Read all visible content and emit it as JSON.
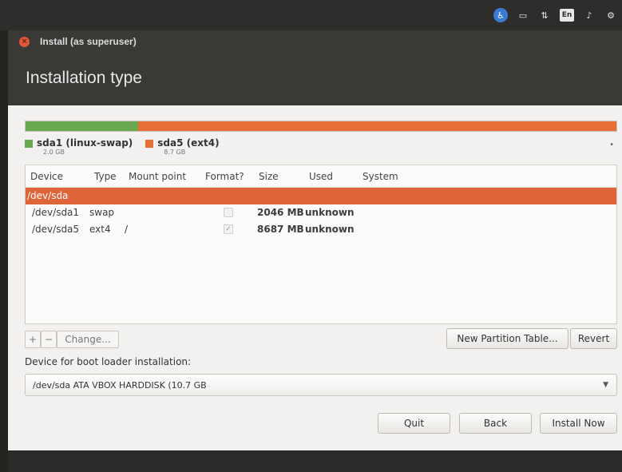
{
  "window": {
    "title": "Install (as superuser)",
    "heading": "Installation type"
  },
  "tray": {
    "accessibility_glyph": "♿",
    "battery_glyph": "▭",
    "network_glyph": "⇅",
    "keyboard_layout": "En",
    "volume_glyph": "♪",
    "settings_glyph": "⚙"
  },
  "partitions": {
    "colors": {
      "swap": "#6aa84f",
      "ext4": "#e66f35"
    },
    "legend": [
      {
        "name": "sda1 (linux-swap)",
        "size": "2.0 GB",
        "color": "#6aa84f"
      },
      {
        "name": "sda5 (ext4)",
        "size": "8.7 GB",
        "color": "#e66f35"
      }
    ],
    "more_glyph": "•"
  },
  "table": {
    "headers": {
      "device": "Device",
      "type": "Type",
      "mount_point": "Mount point",
      "format": "Format?",
      "size": "Size",
      "used": "Used",
      "system": "System"
    },
    "rows": [
      {
        "device": "/dev/sda",
        "type": "",
        "mount": "",
        "format": "",
        "size": "",
        "used": "",
        "system": ""
      },
      {
        "device": "/dev/sda1",
        "type": "swap",
        "mount": "",
        "format": "",
        "size": "2046 MB",
        "used": "unknown",
        "system": ""
      },
      {
        "device": "/dev/sda5",
        "type": "ext4",
        "mount": "/",
        "format": "✓",
        "size": "8687 MB",
        "used": "unknown",
        "system": ""
      }
    ]
  },
  "toolbar": {
    "add": "+",
    "remove": "−",
    "change": "Change...",
    "new_partition_table": "New Partition Table...",
    "revert": "Revert"
  },
  "boot_loader": {
    "label": "Device for boot loader installation:",
    "selected": "/dev/sda   ATA VBOX HARDDISK (10.7 GB",
    "chevron": "▼"
  },
  "actions": {
    "quit": "Quit",
    "back": "Back",
    "install_now": "Install Now"
  }
}
